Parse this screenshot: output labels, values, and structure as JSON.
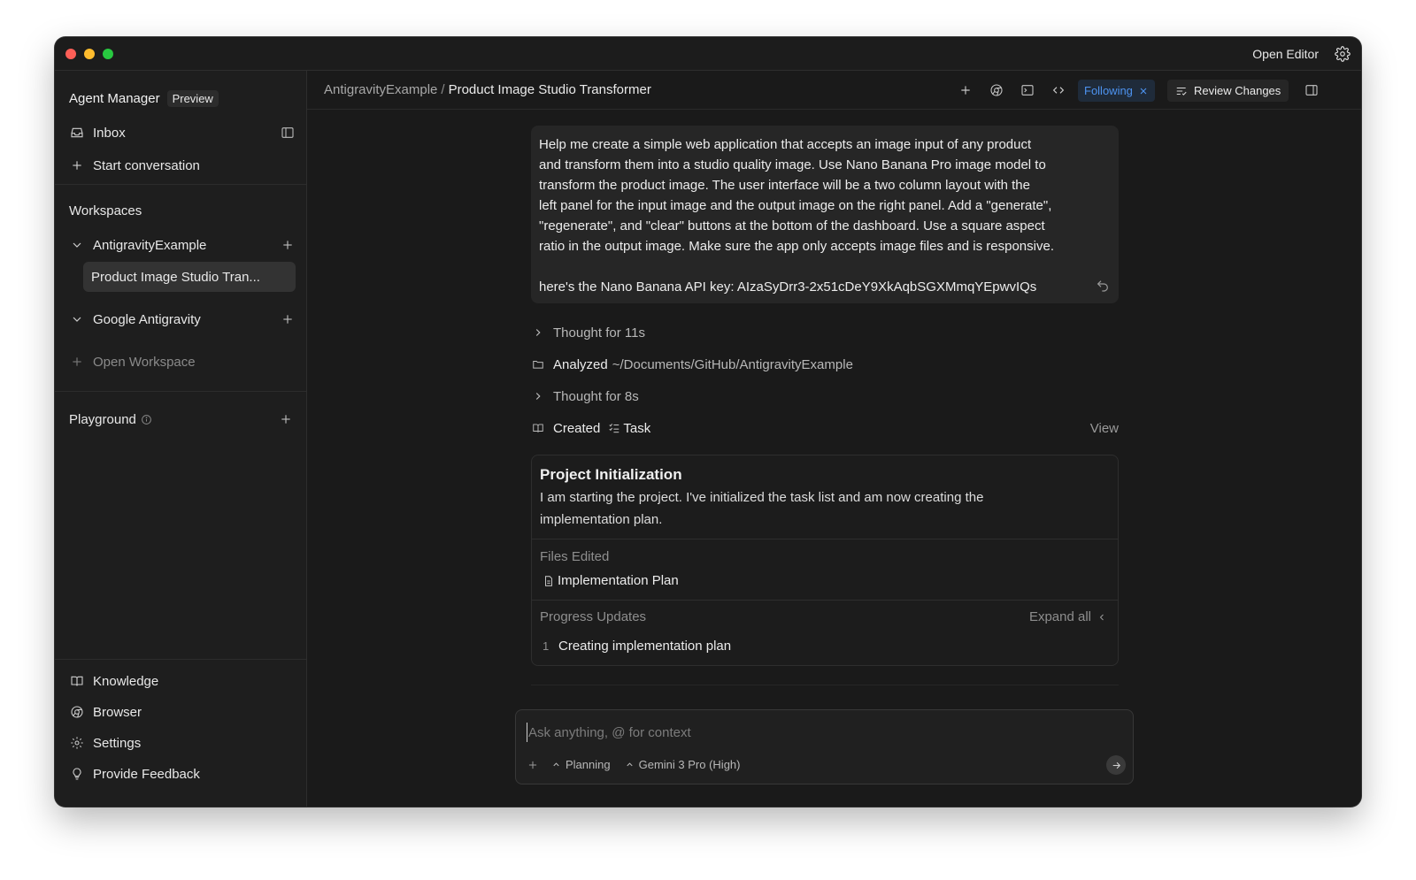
{
  "titlebar": {
    "open_editor": "Open Editor"
  },
  "sidebar": {
    "title": "Agent Manager",
    "badge": "Preview",
    "inbox": "Inbox",
    "start_conversation": "Start conversation",
    "workspaces_label": "Workspaces",
    "workspaces": [
      {
        "name": "AntigravityExample",
        "conversations": [
          "Product Image Studio Tran..."
        ]
      },
      {
        "name": "Google Antigravity",
        "conversations": []
      }
    ],
    "open_workspace": "Open Workspace",
    "playground": "Playground",
    "footer": [
      "Knowledge",
      "Browser",
      "Settings",
      "Provide Feedback"
    ]
  },
  "toolbar": {
    "breadcrumb_workspace": "AntigravityExample",
    "breadcrumb_sep": "/",
    "breadcrumb_conversation": "Product Image Studio Transformer",
    "following": "Following",
    "review_changes": "Review Changes"
  },
  "message": {
    "lines": [
      "Help me create a simple web application that accepts an image input of any product",
      "and transform them into a studio quality image. Use Nano Banana Pro image model to",
      "transform the product image. The user interface will be a two column layout with the",
      "left panel for the input image and the output image on the right panel. Add a \"generate\",",
      "\"regenerate\", and \"clear\" buttons at the bottom of the dashboard. Use a square aspect",
      "ratio in the output image. Make sure the app only accepts image files and is responsive."
    ],
    "api_line": "here's the Nano Banana API key: AIzaSyDrr3-2x51cDeY9XkAqbSGXMmqYEpwvIQs"
  },
  "steps": {
    "thought1": "Thought for 11s",
    "analyzed_label": "Analyzed",
    "analyzed_path": "~/Documents/GitHub/AntigravityExample",
    "thought2": "Thought for 8s",
    "created_label": "Created",
    "created_item": "Task",
    "view": "View"
  },
  "card": {
    "title": "Project Initialization",
    "desc_line1": "I am starting the project. I've initialized the task list and am now creating the",
    "desc_line2": "implementation plan.",
    "files_label": "Files Edited",
    "file": "Implementation Plan",
    "progress_label": "Progress Updates",
    "expand_all": "Expand all",
    "updates": [
      {
        "num": "1",
        "text": "Creating implementation plan"
      }
    ]
  },
  "composer": {
    "placeholder": "Ask anything, @ for context",
    "mode": "Planning",
    "model": "Gemini 3 Pro (High)"
  }
}
